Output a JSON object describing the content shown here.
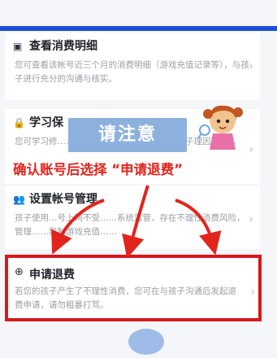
{
  "cards": [
    {
      "icon": "receipt-icon",
      "icon_glyph": "▣",
      "title": "查看消费明细",
      "desc": "您可查看该帐号近三个月的消费明细（游戏充值记录等），与孩子进行充分的沟通与核实。"
    },
    {
      "icon": "lock-icon",
      "icon_glyph": "🔒",
      "title": "学习保",
      "desc": "您可学习修……沟通技巧，也可……巧，让孩子理因对……"
    },
    {
      "icon": "account-icon",
      "icon_glyph": "👥",
      "title": "设置帐号管理",
      "desc": "孩子使用…号上网不受……系统监管，存在不理性消费风险，管理……限制游戏充值……"
    }
  ],
  "callout": {
    "text": "请注意"
  },
  "instruction": {
    "text": "确认账号后选择 “申请退费”"
  },
  "refund": {
    "icon": "plus-circle-icon",
    "icon_glyph": "⊕",
    "title": "申请退费",
    "desc": "若您的孩子产生了不理性消费，您可在与孩子沟通后发起退费申请，请勿粗暴打骂。"
  },
  "colors": {
    "accent_blue": "#1a4fd6",
    "callout_blue": "#8db1dd",
    "warning_red": "#e2241c",
    "highlight_red": "#d8181a"
  }
}
